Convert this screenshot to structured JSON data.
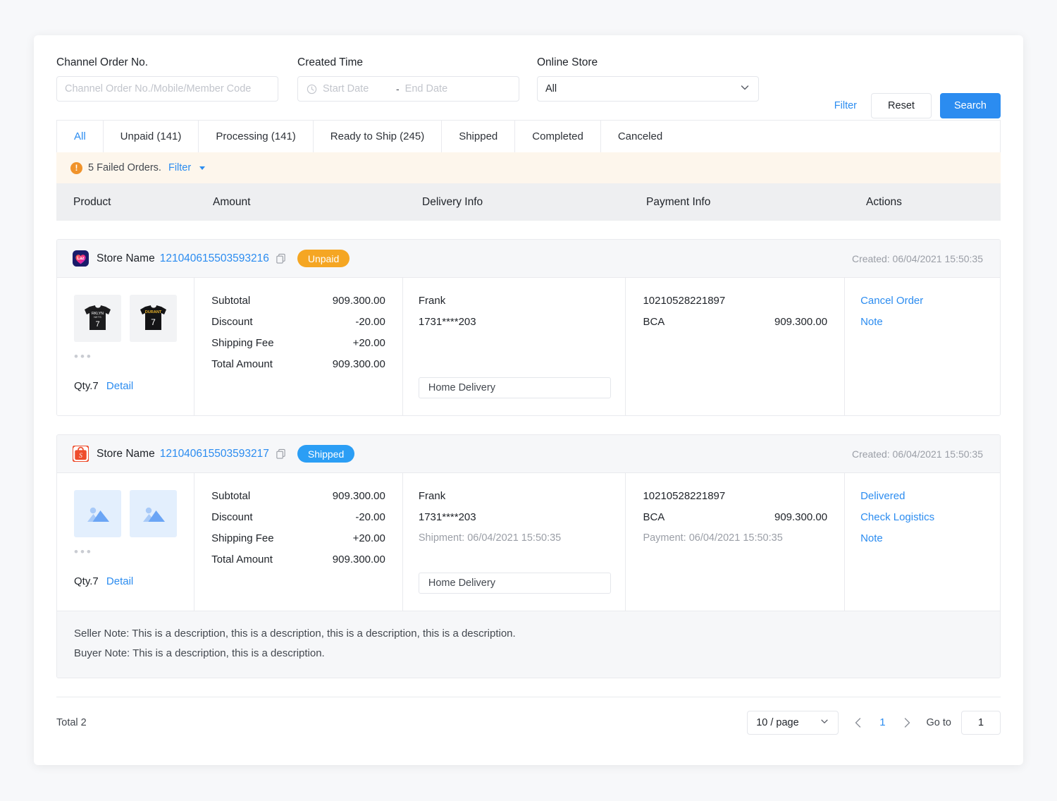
{
  "filters": {
    "order_no": {
      "label": "Channel Order No.",
      "placeholder": "Channel Order No./Mobile/Member Code",
      "value": ""
    },
    "created_time": {
      "label": "Created Time",
      "start_placeholder": "Start Date",
      "end_placeholder": "End Date",
      "separator": "-"
    },
    "online_store": {
      "label": "Online Store",
      "value": "All"
    },
    "filter_link": "Filter",
    "reset_button": "Reset",
    "search_button": "Search"
  },
  "tabs": [
    {
      "label": "All",
      "active": true
    },
    {
      "label": "Unpaid (141)",
      "active": false
    },
    {
      "label": "Processing (141)",
      "active": false
    },
    {
      "label": "Ready to Ship (245)",
      "active": false
    },
    {
      "label": "Shipped",
      "active": false
    },
    {
      "label": "Completed",
      "active": false
    },
    {
      "label": "Canceled",
      "active": false
    }
  ],
  "alert": {
    "text": "5 Failed Orders.",
    "link": "Filter"
  },
  "table_headers": {
    "product": "Product",
    "amount": "Amount",
    "delivery": "Delivery Info",
    "payment": "Payment Info",
    "actions": "Actions"
  },
  "orders": [
    {
      "channel": "lazada",
      "store_name": "Store Name",
      "order_no": "121040615503593216",
      "status": "Unpaid",
      "status_color": "#f5a623",
      "created": "Created: 06/04/2021 15:50:35",
      "product": {
        "qty": "Qty.7",
        "detail": "Detail",
        "thumb_type": "jersey"
      },
      "amount": {
        "subtotal_label": "Subtotal",
        "subtotal_value": "909.300.00",
        "discount_label": "Discount",
        "discount_value": "-20.00",
        "shipping_label": "Shipping Fee",
        "shipping_value": "+20.00",
        "total_label": "Total Amount",
        "total_value": "909.300.00"
      },
      "delivery": {
        "name": "Frank",
        "phone": "1731****203",
        "timestamp": "",
        "method": "Home Delivery"
      },
      "payment": {
        "transaction_no": "10210528221897",
        "method": "BCA",
        "value": "909.300.00",
        "timestamp": ""
      },
      "actions": [
        "Cancel Order",
        "Note"
      ],
      "notes": null
    },
    {
      "channel": "shopee",
      "store_name": "Store Name",
      "order_no": "121040615503593217",
      "status": "Shipped",
      "status_color": "#2b9ef5",
      "created": "Created: 06/04/2021 15:50:35",
      "product": {
        "qty": "Qty.7",
        "detail": "Detail",
        "thumb_type": "placeholder"
      },
      "amount": {
        "subtotal_label": "Subtotal",
        "subtotal_value": "909.300.00",
        "discount_label": "Discount",
        "discount_value": "-20.00",
        "shipping_label": "Shipping Fee",
        "shipping_value": "+20.00",
        "total_label": "Total Amount",
        "total_value": "909.300.00"
      },
      "delivery": {
        "name": "Frank",
        "phone": "1731****203",
        "timestamp": "Shipment: 06/04/2021 15:50:35",
        "method": "Home Delivery"
      },
      "payment": {
        "transaction_no": "10210528221897",
        "method": "BCA",
        "value": "909.300.00",
        "timestamp": "Payment: 06/04/2021 15:50:35"
      },
      "actions": [
        "Delivered",
        "Check Logistics",
        "Note"
      ],
      "notes": {
        "seller": "Seller Note: This is a description, this is a description, this is a description, this is a description.",
        "buyer": "Buyer Note:  This is a description, this is a description."
      }
    }
  ],
  "footer": {
    "total": "Total 2",
    "page_size": "10 / page",
    "current_page": "1",
    "goto_label": "Go to",
    "goto_value": "1"
  },
  "colors": {
    "accent": "#2b8cf0",
    "warning": "#f0932b",
    "unpaid": "#f5a623",
    "shipped": "#2b9ef5"
  }
}
